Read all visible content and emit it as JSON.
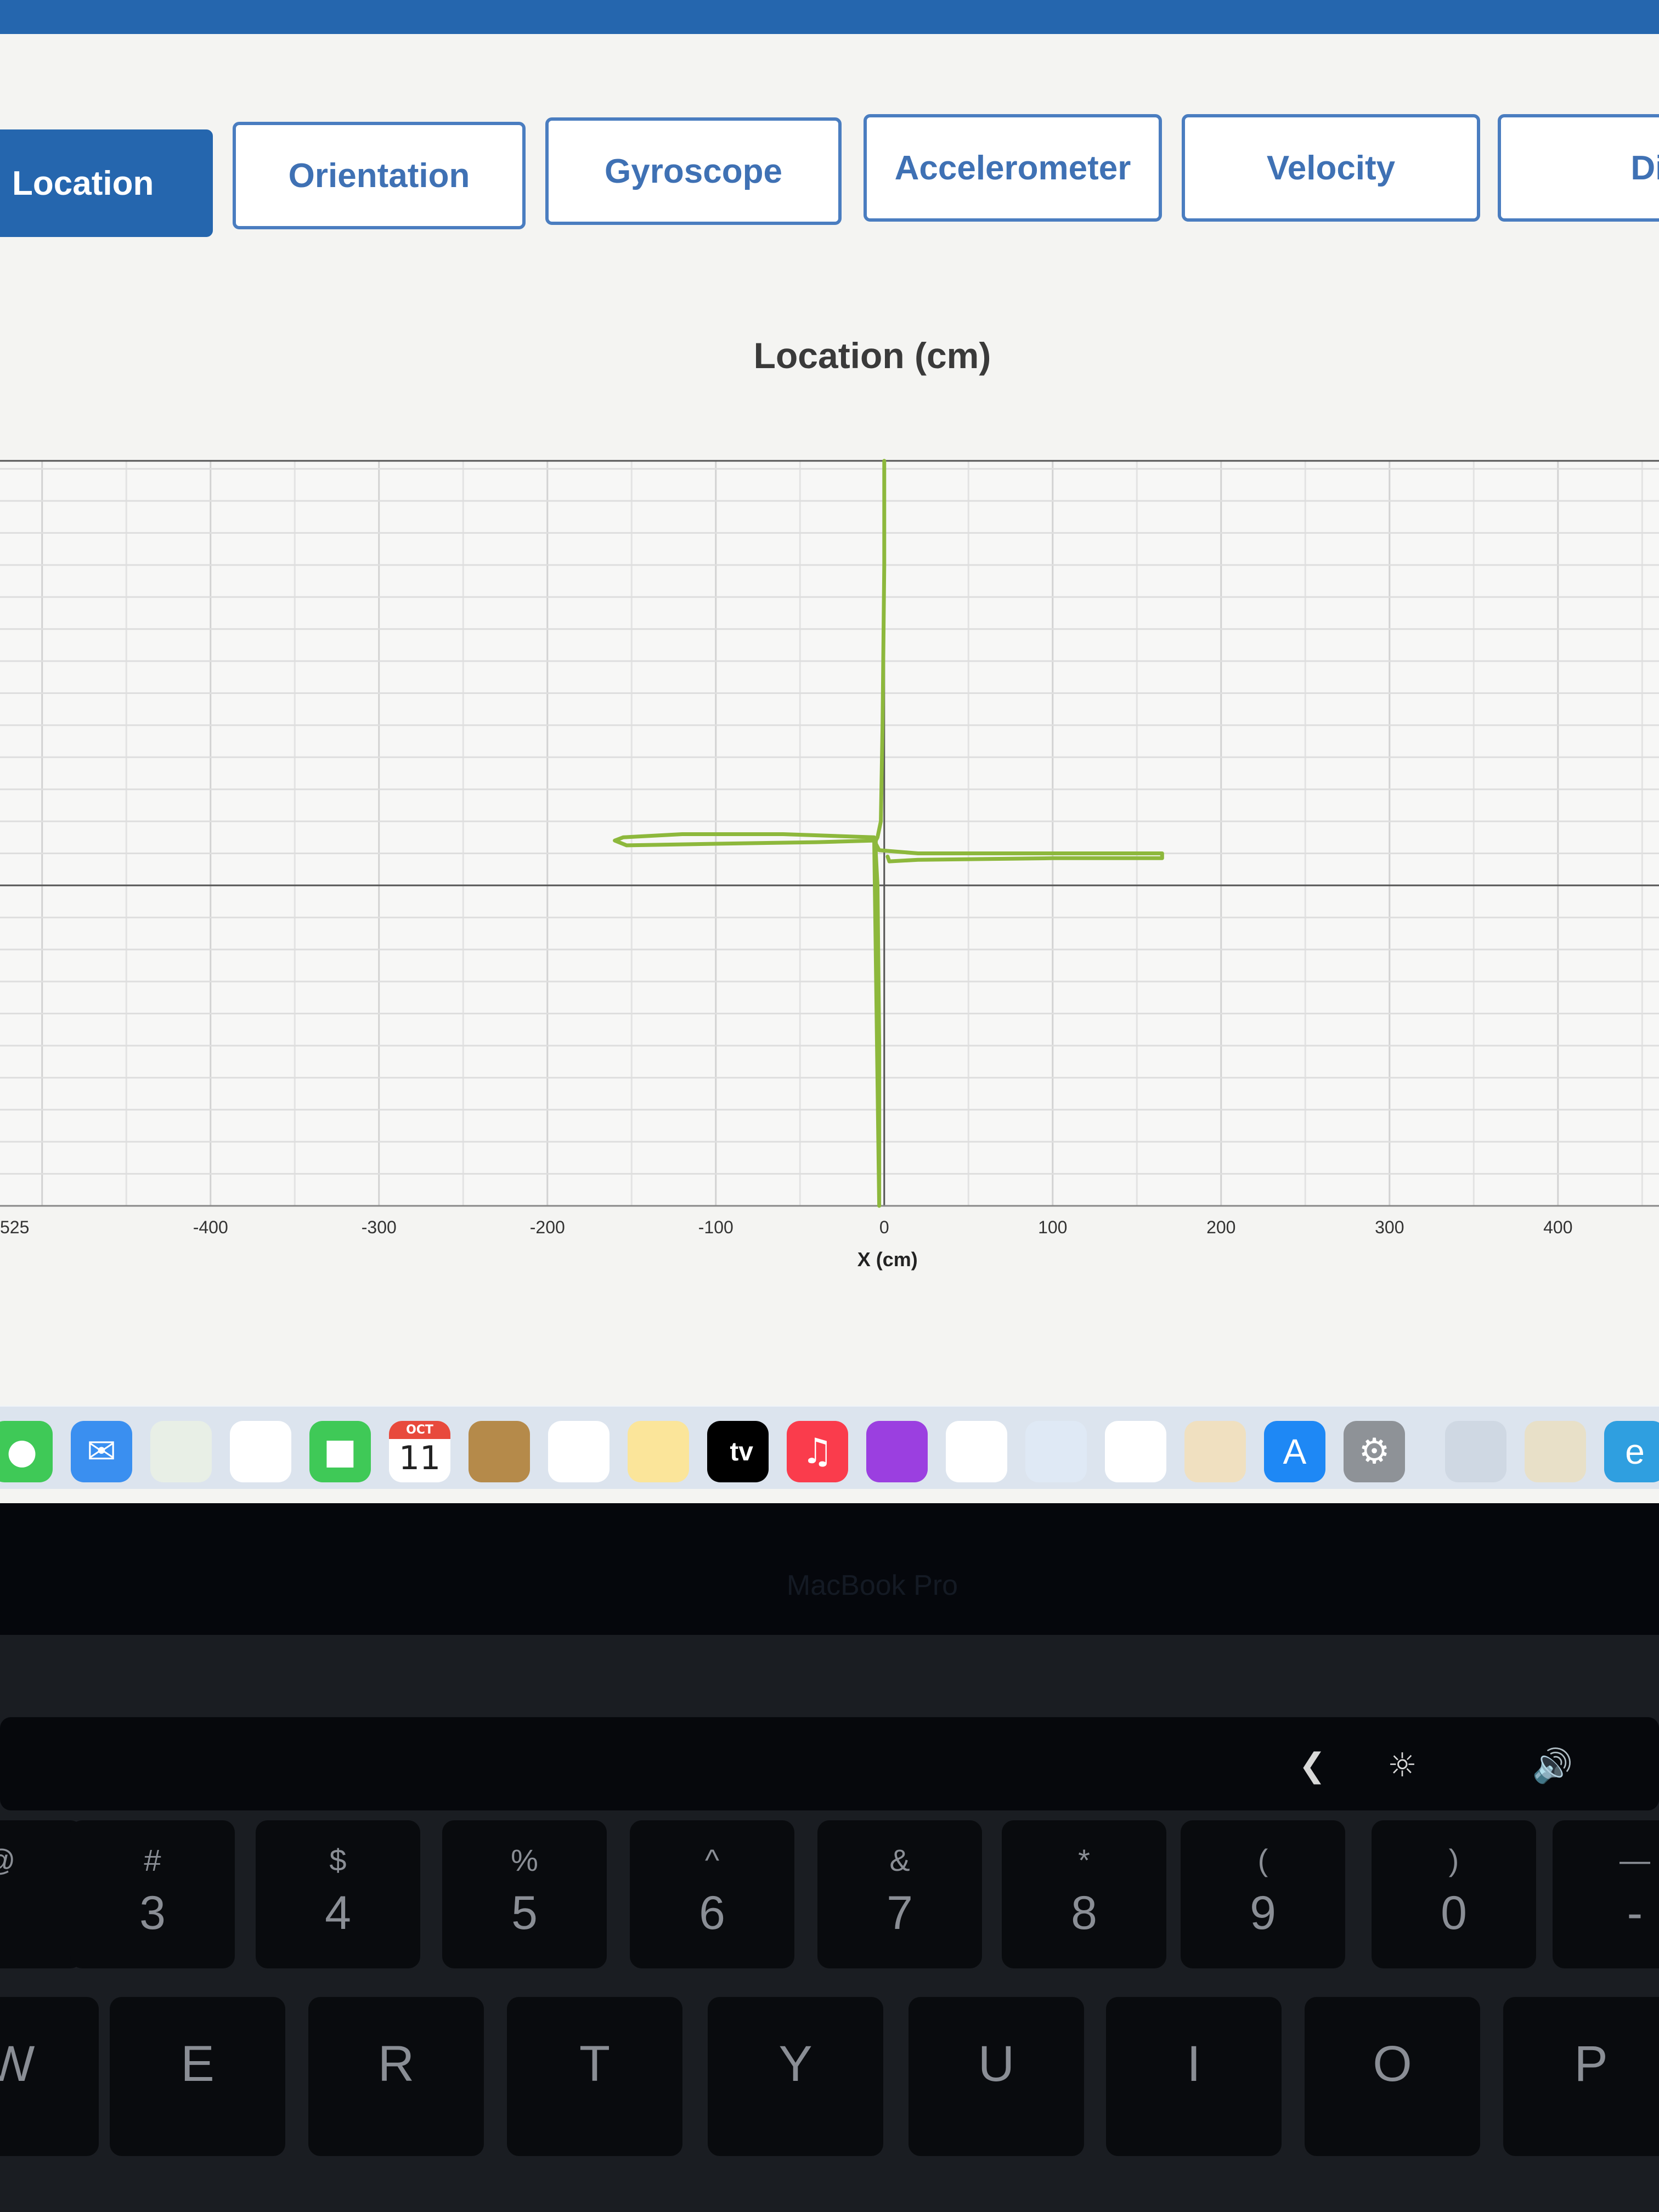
{
  "tabs": [
    {
      "label": "Location",
      "active": true
    },
    {
      "label": "Orientation",
      "active": false
    },
    {
      "label": "Gyroscope",
      "active": false
    },
    {
      "label": "Accelerometer",
      "active": false
    },
    {
      "label": "Velocity",
      "active": false
    },
    {
      "label": "Dista",
      "active": false
    }
  ],
  "chart": {
    "title": "Location (cm)",
    "xlabel": "X (cm)",
    "x_tick_labels": [
      "525",
      "-400",
      "-300",
      "-200",
      "-100",
      "0",
      "100",
      "200",
      "300",
      "400"
    ]
  },
  "chart_data": {
    "type": "line",
    "title": "Location (cm)",
    "xlabel": "X (cm)",
    "ylabel": "",
    "xlim": [
      -525,
      460
    ],
    "ylim": [
      -200,
      265
    ],
    "grid": true,
    "color": "#8db83c",
    "series": [
      {
        "x": [
          0,
          0,
          -1,
          -2,
          -4,
          -5,
          -5,
          -4,
          -3,
          -3,
          -6,
          -60,
          -120,
          -155,
          -160,
          -153,
          -100,
          -40,
          -6,
          -3,
          20,
          100,
          165,
          165,
          100,
          20,
          3,
          2
        ],
        "y": [
          265,
          200,
          100,
          40,
          30,
          28,
          20,
          0,
          -100,
          -200,
          30,
          32,
          32,
          30,
          28,
          25,
          26,
          27,
          28,
          22,
          20,
          20,
          20,
          17,
          17,
          16,
          15,
          18
        ]
      }
    ]
  },
  "dock": {
    "apps": [
      {
        "icon": "messages-icon",
        "bg": "#3fc957"
      },
      {
        "icon": "mail-icon",
        "bg": "#3a8ff0"
      },
      {
        "icon": "maps-icon",
        "bg": "#e8efe6"
      },
      {
        "icon": "photos-icon",
        "bg": "#ffffff"
      },
      {
        "icon": "facetime-icon",
        "bg": "#3fc957"
      },
      {
        "icon": "calendar-icon",
        "bg": "#ffffff"
      },
      {
        "icon": "contacts-icon",
        "bg": "#b58a4a"
      },
      {
        "icon": "reminders-icon",
        "bg": "#ffffff"
      },
      {
        "icon": "notes-icon",
        "bg": "#fbe59a"
      },
      {
        "icon": "tv-icon",
        "bg": "#000000"
      },
      {
        "icon": "music-icon",
        "bg": "#fa3c4c"
      },
      {
        "icon": "podcasts-icon",
        "bg": "#9b3fe0"
      },
      {
        "icon": "news-icon",
        "bg": "#ffffff"
      },
      {
        "icon": "keynote-icon",
        "bg": "#dfe9f5"
      },
      {
        "icon": "numbers-icon",
        "bg": "#ffffff"
      },
      {
        "icon": "pages-icon",
        "bg": "#f0e0c0"
      },
      {
        "icon": "app-store-icon",
        "bg": "#1e88f5"
      },
      {
        "icon": "system-settings-icon",
        "bg": "#8e9297"
      },
      {
        "icon": "preview-icon",
        "bg": "#cfd8e3"
      },
      {
        "icon": "python-icon",
        "bg": "#e8e0c8"
      },
      {
        "icon": "edge-icon",
        "bg": "#2f9fe0"
      }
    ],
    "calendar_month": "OCT",
    "calendar_day": "11",
    "tv_label": " tv"
  },
  "bezel_label": "MacBook Pro",
  "keyboard": {
    "number_row": [
      {
        "shift": "@",
        "main": ""
      },
      {
        "shift": "#",
        "main": "3"
      },
      {
        "shift": "$",
        "main": "4"
      },
      {
        "shift": "%",
        "main": "5"
      },
      {
        "shift": "^",
        "main": "6"
      },
      {
        "shift": "&",
        "main": "7"
      },
      {
        "shift": "*",
        "main": "8"
      },
      {
        "shift": "(",
        "main": "9"
      },
      {
        "shift": ")",
        "main": "0"
      },
      {
        "shift": "—",
        "main": "-"
      }
    ],
    "letter_row": [
      "W",
      "E",
      "R",
      "T",
      "Y",
      "U",
      "I",
      "O",
      "P"
    ]
  }
}
